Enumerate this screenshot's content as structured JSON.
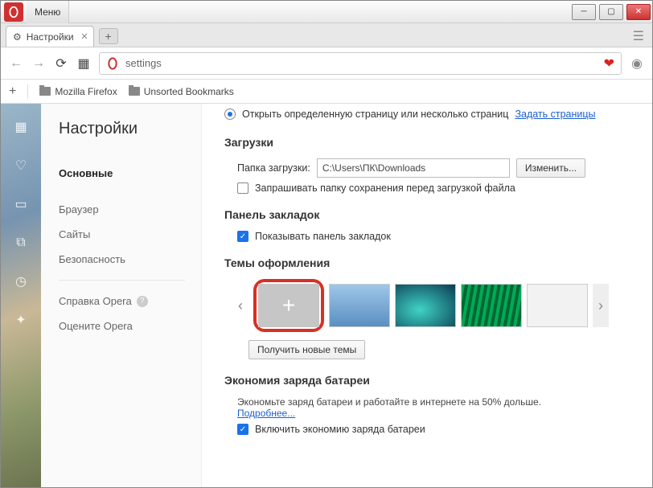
{
  "titlebar": {
    "menu": "Меню"
  },
  "tab": {
    "title": "Настройки"
  },
  "address": {
    "value": "settings"
  },
  "bookmarks": {
    "add": "+",
    "items": [
      "Mozilla Firefox",
      "Unsorted Bookmarks"
    ]
  },
  "nav": {
    "heading": "Настройки",
    "items": [
      "Основные",
      "Браузер",
      "Сайты",
      "Безопасность"
    ],
    "help": "Справка Opera",
    "rate": "Оцените Opera"
  },
  "startup": {
    "option": "Открыть определенную страницу или несколько страниц",
    "set_pages": "Задать страницы"
  },
  "downloads": {
    "heading": "Загрузки",
    "folder_label": "Папка загрузки:",
    "folder_value": "C:\\Users\\ПК\\Downloads",
    "change": "Изменить...",
    "ask": "Запрашивать папку сохранения перед загрузкой файла"
  },
  "bookmarks_panel": {
    "heading": "Панель закладок",
    "show": "Показывать панель закладок"
  },
  "themes": {
    "heading": "Темы оформления",
    "get_more": "Получить новые темы"
  },
  "battery": {
    "heading": "Экономия заряда батареи",
    "desc": "Экономьте заряд батареи и работайте в интернете на 50% дольше.",
    "more": "Подробнее...",
    "enable": "Включить экономию заряда батареи"
  }
}
